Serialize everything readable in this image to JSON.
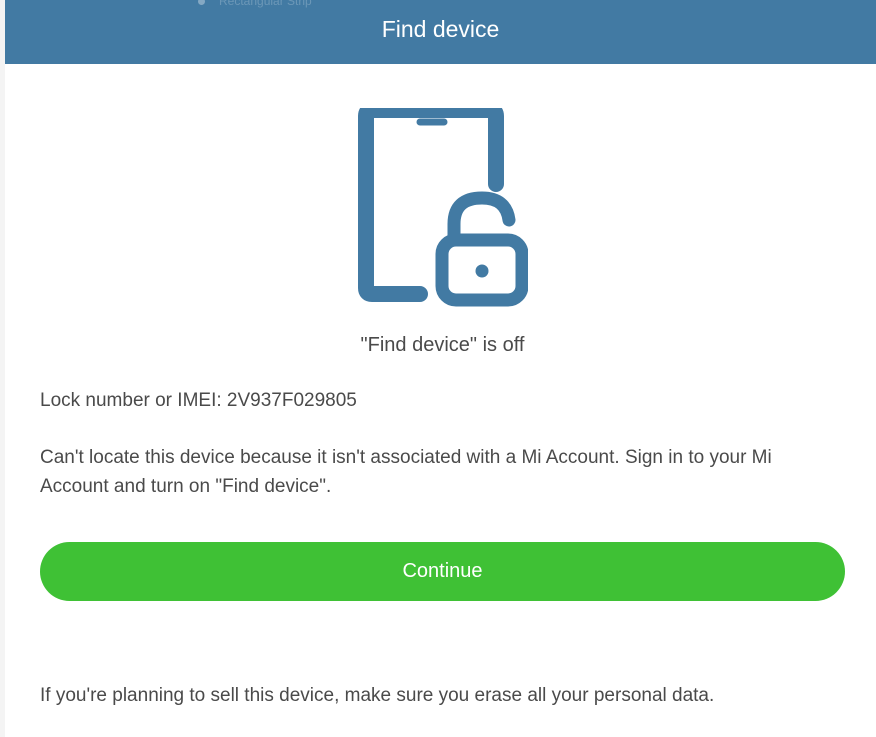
{
  "backdrop": {
    "item_label": "Rectangular Strip"
  },
  "dialog": {
    "title": "Find device",
    "icon": "phone-unlocked-icon",
    "status_text": "\"Find device\" is off",
    "lock_label": "Lock number or IMEI: 2V937F029805",
    "description": "Can't locate this device because it isn't associated with a Mi Account. Sign in to your Mi Account and turn on \"Find device\".",
    "continue_label": "Continue",
    "footer_note": "If you're planning to sell this device, make sure you erase all your personal data."
  },
  "colors": {
    "header_bg": "#427aa3",
    "icon": "#427aa3",
    "button_bg": "#3fc135",
    "text": "#4a4a4a"
  }
}
